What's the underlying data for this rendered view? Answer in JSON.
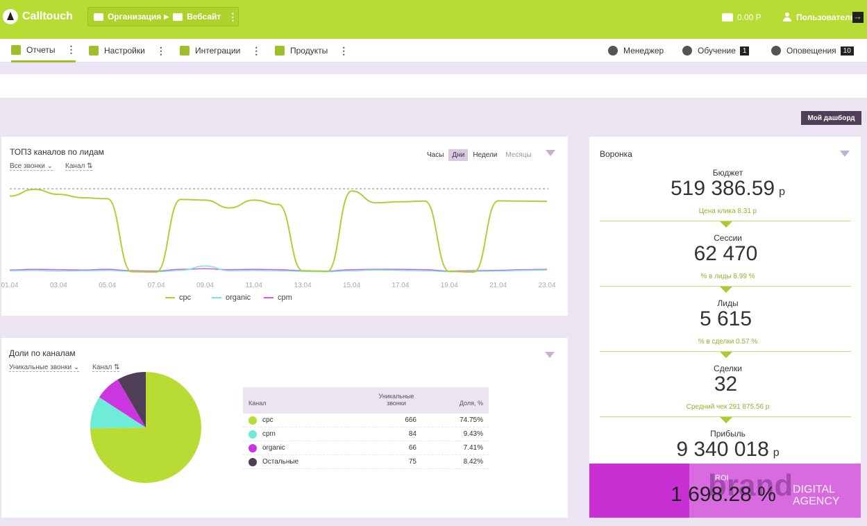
{
  "header": {
    "logo_text": "Calltouch",
    "breadcrumb": [
      "Организация",
      "Вебсайт"
    ],
    "balance": "0.00 Р",
    "user_label": "Пользователь"
  },
  "nav": {
    "items": [
      {
        "label": "Отчеты",
        "icon": "reports-icon"
      },
      {
        "label": "Настройки",
        "icon": "settings-icon"
      },
      {
        "label": "Интеграции",
        "icon": "integrations-icon"
      },
      {
        "label": "Продукты",
        "icon": "products-icon"
      }
    ],
    "right": [
      {
        "label": "Менеджер",
        "icon": "manager-icon"
      },
      {
        "label": "Обучение",
        "icon": "graduation-cap-icon",
        "badge": "1"
      },
      {
        "label": "Оповещения",
        "icon": "bell-icon",
        "badge": "10"
      }
    ]
  },
  "dashboard_button": "Мой дашборд",
  "top_channels": {
    "title": "ТОП3 каналов по лидам",
    "filters": [
      "Все звонки",
      "Канал"
    ],
    "periods": [
      "Часы",
      "Дни",
      "Недели",
      "Месяцы"
    ],
    "selected_period": "Дни"
  },
  "shares": {
    "title": "Доли по каналам",
    "filters": [
      "Уникальные звонки",
      "Канал"
    ],
    "table": {
      "headers": [
        "Канал",
        "Уникальные звонки",
        "Доля, %"
      ],
      "rows": [
        {
          "channel": "cpc",
          "calls": "666",
          "share": "74.75%",
          "color": "#b8dc34"
        },
        {
          "channel": "cpm",
          "calls": "84",
          "share": "9.43%",
          "color": "#6fecd8"
        },
        {
          "channel": "organic",
          "calls": "66",
          "share": "7.41%",
          "color": "#cc36e0"
        },
        {
          "channel": "Остальные",
          "calls": "75",
          "share": "8.42%",
          "color": "#4f3f56"
        }
      ]
    }
  },
  "funnel": {
    "title": "Воронка",
    "steps": [
      {
        "label": "Бюджет",
        "value": "519 386.59",
        "unit": "р",
        "sub": "Цена клика 8.31 р"
      },
      {
        "label": "Сессии",
        "value": "62 470",
        "unit": "",
        "sub": "% в лиды 8.99 %"
      },
      {
        "label": "Лиды",
        "value": "5 615",
        "unit": "",
        "sub": "% в сделки 0.57 %"
      },
      {
        "label": "Сделки",
        "value": "32",
        "unit": "",
        "sub": "Средний чек 291 875.56 р"
      },
      {
        "label": "Прибыль",
        "value": "9 340 018",
        "unit": "р",
        "sub": ""
      }
    ],
    "roi_label": "ROI",
    "roi_value": "1 698.28 %"
  },
  "watermark": {
    "brand": "brand",
    "line1": "DIGITAL",
    "line2": "AGENCY"
  },
  "chart_data": [
    {
      "type": "line",
      "title": "ТОП3 каналов по лидам",
      "x": [
        "01.04",
        "02.04",
        "03.04",
        "04.04",
        "05.04",
        "06.04",
        "07.04",
        "08.04",
        "09.04",
        "10.04",
        "11.04",
        "12.04",
        "13.04",
        "14.04",
        "15.04",
        "16.04",
        "17.04",
        "18.04",
        "19.04",
        "20.04",
        "21.04",
        "22.04",
        "23.04"
      ],
      "xticks": [
        "01.04",
        "03.04",
        "05.04",
        "07.04",
        "09.04",
        "11.04",
        "13.04",
        "15.04",
        "17.04",
        "19.04",
        "21.04",
        "23.04"
      ],
      "series": [
        {
          "name": "cpc",
          "color": "#aed034",
          "values": [
            230,
            250,
            235,
            225,
            222,
            5,
            4,
            220,
            218,
            195,
            218,
            205,
            8,
            6,
            245,
            210,
            213,
            215,
            6,
            4,
            216,
            215,
            214
          ]
        },
        {
          "name": "organic",
          "color": "#6fecd8",
          "values": [
            8,
            9,
            7,
            8,
            9,
            6,
            5,
            9,
            22,
            8,
            9,
            8,
            6,
            5,
            8,
            10,
            9,
            8,
            5,
            6,
            7,
            9,
            10
          ]
        },
        {
          "name": "cpm",
          "color": "#dd55e6",
          "values": [
            10,
            12,
            11,
            10,
            12,
            8,
            7,
            12,
            14,
            11,
            12,
            11,
            8,
            7,
            11,
            12,
            12,
            11,
            7,
            8,
            9,
            11,
            12
          ]
        }
      ],
      "legend_placement": "bottom",
      "ylim": [
        0,
        260
      ]
    },
    {
      "type": "pie",
      "title": "Доли по каналам",
      "categories": [
        "cpc",
        "cpm",
        "organic",
        "Остальные"
      ],
      "values": [
        666,
        84,
        66,
        75
      ],
      "colors": [
        "#b8dc34",
        "#6fecd8",
        "#cc36e0",
        "#4f3f56"
      ]
    }
  ]
}
